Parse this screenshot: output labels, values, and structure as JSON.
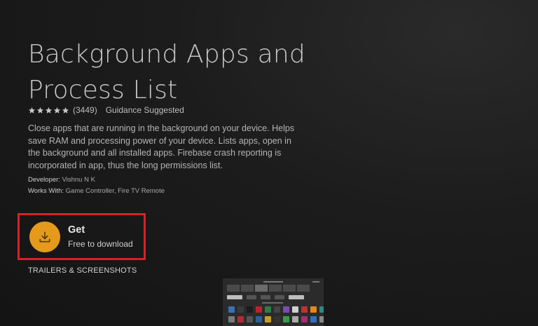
{
  "app": {
    "title": "Background Apps and Process List",
    "rating": {
      "stars": 5,
      "count": "(3449)",
      "guidance": "Guidance Suggested"
    },
    "description": "Close apps that are running in the background on your device. Helps save RAM and processing power of your device. Lists apps, open in the background and all installed apps. Firebase crash reporting is incorporated in app, thus the long permissions list.",
    "developer_label": "Developer:",
    "developer": "Vishnu N K",
    "works_with_label": "Works With:",
    "works_with": "Game Controller, Fire TV Remote"
  },
  "get_button": {
    "label": "Get",
    "sublabel": "Free to download",
    "icon": "download-icon"
  },
  "sections": {
    "trailers_heading": "TRAILERS & SCREENSHOTS"
  },
  "colors": {
    "accent": "#e59a1b",
    "highlight": "#d8202a",
    "background": "#1c1c1c",
    "star": "#c9c9c9"
  },
  "thumbnail": {
    "icon_colors_row1": [
      "#3b6fb6",
      "#3a3a3a",
      "#1b1b1b",
      "#c0202a",
      "#2d7d46",
      "#444",
      "#7a4bb5",
      "#d0d0d0",
      "#b33",
      "#e08a1b",
      "#2a8a8a",
      "#444"
    ],
    "icon_colors_row2": [
      "#7a7a7a",
      "#b52a2a",
      "#555",
      "#2a5fa0",
      "#c7a020",
      "#333",
      "#3a9a4a",
      "#aaa",
      "#a03070",
      "#2f72c0",
      "#888",
      "#c05020"
    ]
  }
}
